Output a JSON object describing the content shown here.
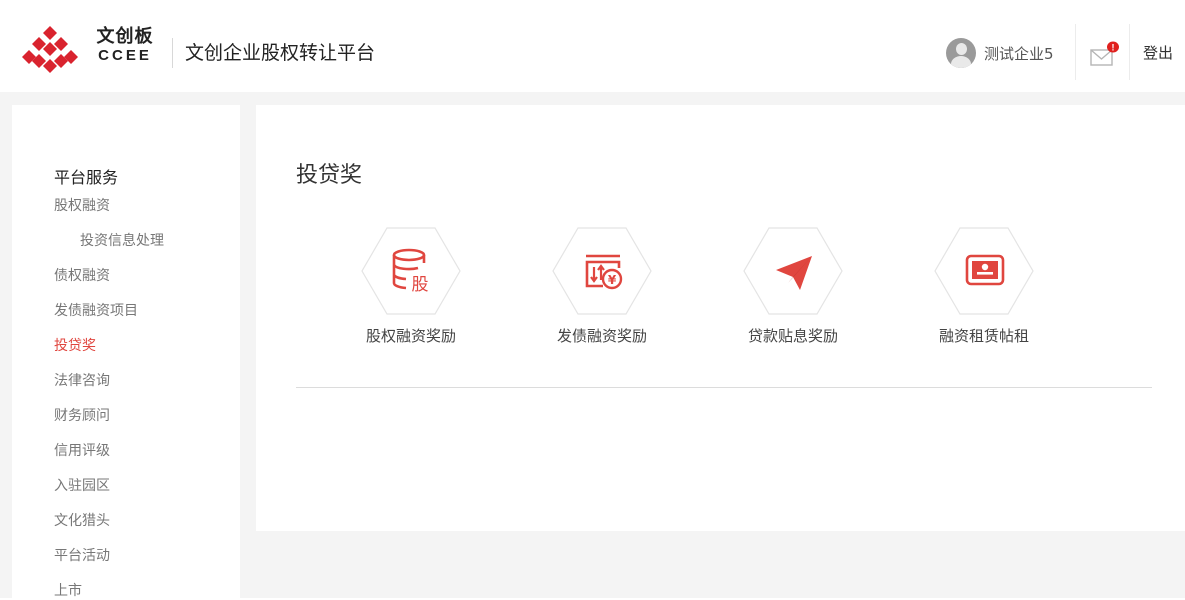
{
  "header": {
    "logo_cn": "文创板",
    "logo_en": "CCEE",
    "site_title": "文创企业股权转让平台",
    "user_name": "测试企业5",
    "logout_label": "登出"
  },
  "sidebar": {
    "title": "平台服务",
    "items": [
      {
        "label": "股权融资"
      },
      {
        "label": "投资信息处理"
      },
      {
        "label": "债权融资"
      },
      {
        "label": "发债融资项目"
      },
      {
        "label": "投贷奖"
      },
      {
        "label": "法律咨询"
      },
      {
        "label": "财务顾问"
      },
      {
        "label": "信用评级"
      },
      {
        "label": "入驻园区"
      },
      {
        "label": "文化猎头"
      },
      {
        "label": "平台活动"
      },
      {
        "label": "上市"
      }
    ]
  },
  "main": {
    "title": "投贷奖",
    "cards": [
      {
        "label": "股权融资奖励",
        "icon": "equity-financing-icon",
        "icon_text": "股"
      },
      {
        "label": "发债融资奖励",
        "icon": "bond-financing-icon",
        "icon_text": "¥"
      },
      {
        "label": "贷款贴息奖励",
        "icon": "paper-plane-icon"
      },
      {
        "label": "融资租赁帖租",
        "icon": "lease-certificate-icon"
      }
    ]
  },
  "colors": {
    "accent": "#e0463f",
    "page_background": "#f4f4f4",
    "hexagon_border": "#e4e4e4"
  }
}
